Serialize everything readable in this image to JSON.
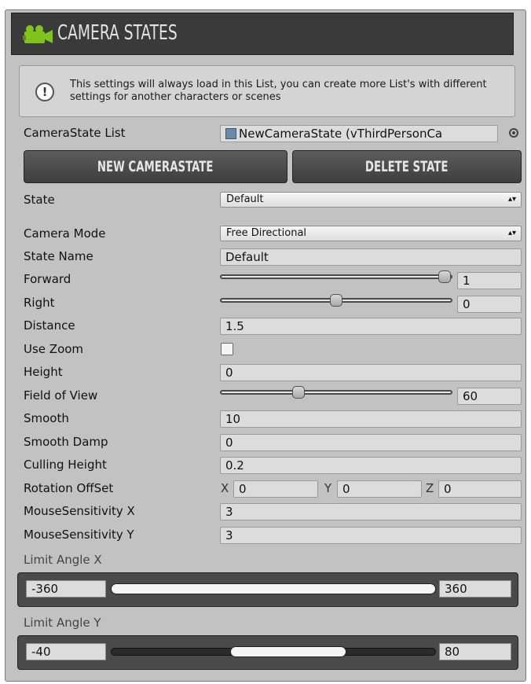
{
  "header": {
    "title": "CAMERA STATES"
  },
  "help": {
    "message": "This settings will always load in this List, you can create more List's with different settings for another characters or scenes"
  },
  "camera_state_list": {
    "label": "CameraState List",
    "value": "NewCameraState (vThirdPersonCa"
  },
  "buttons": {
    "new_state": "NEW CAMERASTATE",
    "delete_state": "DELETE STATE"
  },
  "state": {
    "label": "State",
    "value": "Default"
  },
  "fields": {
    "camera_mode": {
      "label": "Camera Mode",
      "value": "Free Directional"
    },
    "state_name": {
      "label": "State Name",
      "value": "Default"
    },
    "forward": {
      "label": "Forward",
      "value": "1",
      "fraction": 1.0
    },
    "right": {
      "label": "Right",
      "value": "0",
      "fraction": 0.5
    },
    "distance": {
      "label": "Distance",
      "value": "1.5"
    },
    "use_zoom": {
      "label": "Use Zoom",
      "checked": false
    },
    "height": {
      "label": "Height",
      "value": "0"
    },
    "field_of_view": {
      "label": "Field of View",
      "value": "60",
      "fraction": 0.33
    },
    "smooth": {
      "label": "Smooth",
      "value": "10"
    },
    "smooth_damp": {
      "label": "Smooth Damp",
      "value": "0"
    },
    "culling_height": {
      "label": "Culling Height",
      "value": "0.2"
    },
    "rotation_offset": {
      "label": "Rotation OffSet",
      "x_label": "X",
      "x": "0",
      "y_label": "Y",
      "y": "0",
      "z_label": "Z",
      "z": "0"
    },
    "mouse_sensitivity_x": {
      "label": "MouseSensitivity X",
      "value": "3"
    },
    "mouse_sensitivity_y": {
      "label": "MouseSensitivity Y",
      "value": "3"
    }
  },
  "limit_x": {
    "label": "Limit Angle X",
    "min": "-360",
    "max": "360"
  },
  "limit_y": {
    "label": "Limit Angle Y",
    "min": "-40",
    "max": "80"
  }
}
